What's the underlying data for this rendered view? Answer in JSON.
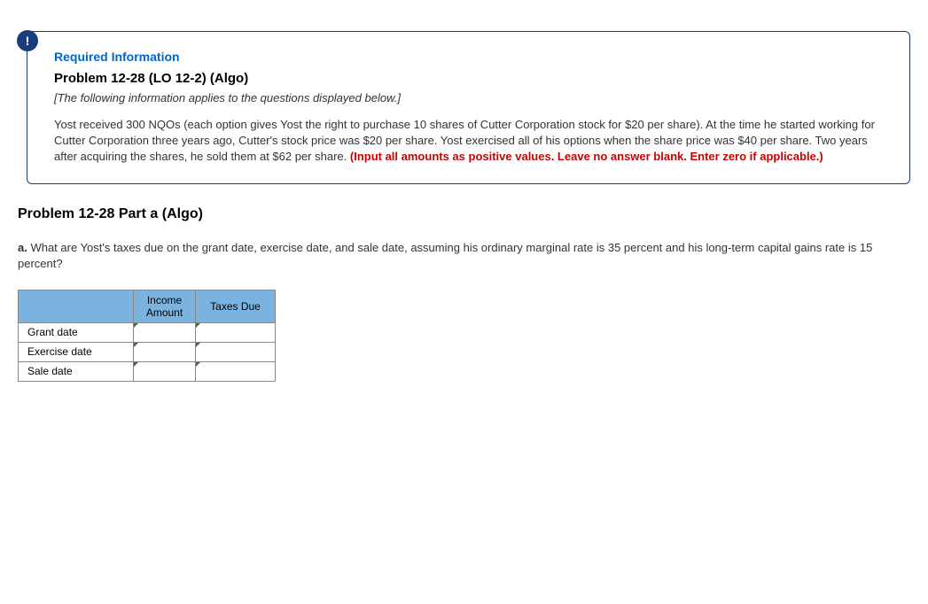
{
  "alert_icon": "!",
  "info_box": {
    "required_label": "Required Information",
    "title": "Problem 12-28 (LO 12-2) (Algo)",
    "note": "[The following information applies to the questions displayed below.]",
    "body_text": "Yost received 300 NQOs (each option gives Yost the right to purchase 10 shares of Cutter Corporation stock for $20 per share). At the time he started working for Cutter Corporation three years ago, Cutter's stock price was $20 per share. Yost exercised all of his options when the share price was $40 per share. Two years after acquiring the shares, he sold them at $62 per share. ",
    "red_instruction": "(Input all amounts as positive values. Leave no answer blank. Enter zero if applicable.)"
  },
  "part_title": "Problem 12-28 Part a (Algo)",
  "question": {
    "prefix": "a.",
    "text": " What are Yost's taxes due on the grant date, exercise date, and sale date, assuming his ordinary marginal rate is 35 percent and his long-term capital gains rate is 15 percent?"
  },
  "table": {
    "headers": {
      "income": "Income Amount",
      "taxes": "Taxes Due"
    },
    "rows": [
      {
        "label": "Grant date",
        "income": "",
        "taxes": ""
      },
      {
        "label": "Exercise date",
        "income": "",
        "taxes": ""
      },
      {
        "label": "Sale date",
        "income": "",
        "taxes": ""
      }
    ]
  }
}
